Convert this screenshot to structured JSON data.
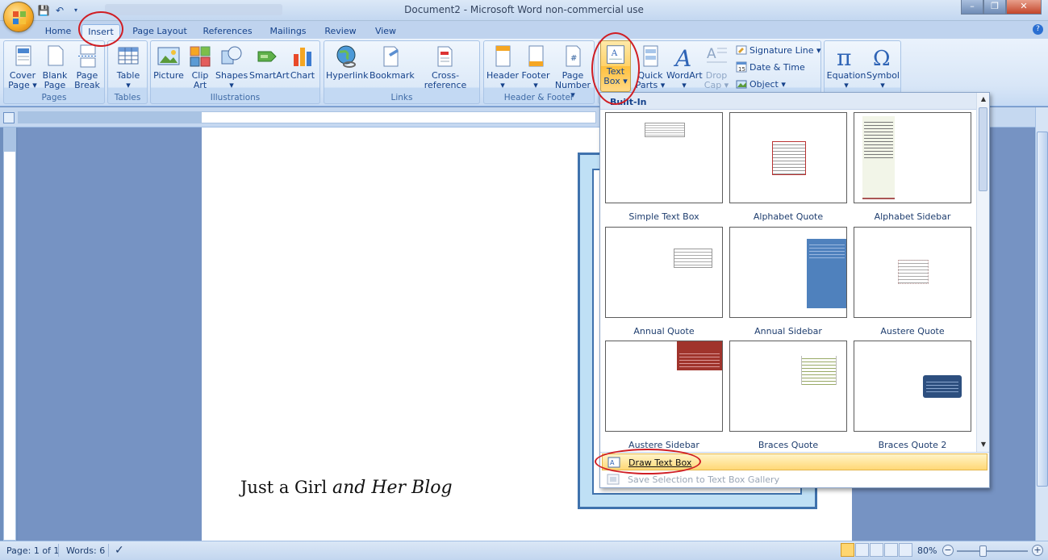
{
  "window": {
    "title": "Document2 - Microsoft Word non-commercial use",
    "minimize_label": "–",
    "restore_label": "❐",
    "close_label": "✕"
  },
  "tabs": [
    {
      "label": "Home"
    },
    {
      "label": "Insert",
      "active": true
    },
    {
      "label": "Page Layout"
    },
    {
      "label": "References"
    },
    {
      "label": "Mailings"
    },
    {
      "label": "Review"
    },
    {
      "label": "View"
    }
  ],
  "ribbon": {
    "groups": {
      "pages": "Pages",
      "tables": "Tables",
      "illustrations": "Illustrations",
      "links": "Links",
      "header_footer": "Header & Footer"
    },
    "buttons": {
      "cover_page": [
        "Cover",
        "Page ▾"
      ],
      "blank_page": [
        "Blank",
        "Page"
      ],
      "page_break": [
        "Page",
        "Break"
      ],
      "table": [
        "Table",
        "▾"
      ],
      "picture": [
        "Picture",
        ""
      ],
      "clip_art": [
        "Clip",
        "Art"
      ],
      "shapes": [
        "Shapes",
        "▾"
      ],
      "smartart": [
        "SmartArt",
        ""
      ],
      "chart": [
        "Chart",
        ""
      ],
      "hyperlink": [
        "Hyperlink",
        ""
      ],
      "bookmark": [
        "Bookmark",
        ""
      ],
      "cross_reference": [
        "Cross-reference",
        ""
      ],
      "header": [
        "Header",
        "▾"
      ],
      "footer": [
        "Footer",
        "▾"
      ],
      "page_number": [
        "Page",
        "Number ▾"
      ],
      "text_box": [
        "Text",
        "Box ▾"
      ],
      "quick_parts": [
        "Quick",
        "Parts ▾"
      ],
      "wordart": [
        "WordArt",
        "▾"
      ],
      "drop_cap": [
        "Drop",
        "Cap ▾"
      ],
      "equation": [
        "Equation",
        "▾"
      ],
      "symbol": [
        "Symbol",
        "▾"
      ]
    },
    "small": {
      "signature_line": "Signature Line ▾",
      "date_time": "Date & Time",
      "object": "Object ▾"
    }
  },
  "gallery": {
    "header": "Built-In",
    "items": [
      {
        "label": "Simple Text Box"
      },
      {
        "label": "Alphabet Quote"
      },
      {
        "label": "Alphabet Sidebar"
      },
      {
        "label": "Annual Quote"
      },
      {
        "label": "Annual Sidebar"
      },
      {
        "label": "Austere Quote"
      },
      {
        "label": "Austere Sidebar"
      },
      {
        "label": "Braces Quote"
      },
      {
        "label": "Braces Quote 2"
      }
    ],
    "menu": {
      "draw_text_box": "Draw Text Box",
      "save_selection": "Save Selection to Text Box Gallery"
    }
  },
  "document": {
    "blog_title_regular": "Just a Girl ",
    "blog_title_script": "and Her Blog"
  },
  "status": {
    "page": "Page: 1 of 1",
    "words": "Words: 6",
    "zoom": "80%"
  },
  "colors": {
    "accent_red": "#d01e24",
    "ribbon_blue": "#15428b",
    "highlight": "#ffd876"
  }
}
